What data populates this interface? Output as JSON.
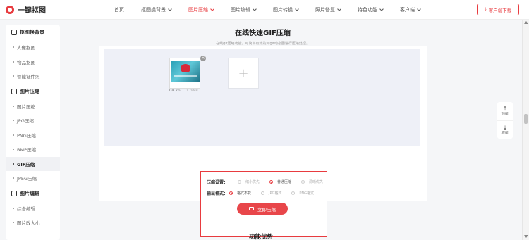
{
  "header": {
    "logo_text": "一键抠图",
    "nav": [
      {
        "label": "首页",
        "has_dropdown": false,
        "active": false
      },
      {
        "label": "抠图换背景",
        "has_dropdown": true,
        "active": false
      },
      {
        "label": "图片压缩",
        "has_dropdown": true,
        "active": true
      },
      {
        "label": "图片编辑",
        "has_dropdown": true,
        "active": false
      },
      {
        "label": "图片转换",
        "has_dropdown": true,
        "active": false
      },
      {
        "label": "照片修复",
        "has_dropdown": true,
        "active": false
      },
      {
        "label": "特色功能",
        "has_dropdown": true,
        "active": false
      },
      {
        "label": "客户端",
        "has_dropdown": true,
        "active": false
      }
    ],
    "download_label": "客户端下载",
    "accent_color": "#e83b3f"
  },
  "sidebar": {
    "group1": {
      "title": "抠图换背景",
      "items": [
        "人像抠图",
        "物品抠图",
        "智能证件照"
      ]
    },
    "group2": {
      "title": "图片压缩",
      "items": [
        "图片压缩",
        "JPG压缩",
        "PNG压缩",
        "BMP压缩",
        "GIF压缩",
        "JPEG压缩"
      ],
      "active_index": 4
    },
    "group3": {
      "title": "图片编辑",
      "items": [
        "综合编辑",
        "图片改大小"
      ]
    }
  },
  "main": {
    "title": "在线快速GIF压缩",
    "subtitle": "在线gif压缩功能，可简单有效的对gif动态图进行压缩处理。",
    "file": {
      "name": "GIF 202...",
      "size": "1.79MB"
    },
    "add_symbol": "+",
    "settings": {
      "compress_label": "压缩设置：",
      "compress_options": [
        "缩小优先",
        "普通压缩",
        "清晰优先"
      ],
      "compress_selected": 1,
      "format_label": "输出格式：",
      "format_options": [
        "格式不变",
        "JPG格式",
        "PNG格式"
      ],
      "format_selected": 0,
      "button_label": "立即压缩"
    },
    "next_section_title": "功能优势"
  },
  "float_tools": {
    "top_label": "顶部",
    "top_icon": "⤒",
    "bottom_label": "底部",
    "bottom_icon": "⤓"
  }
}
